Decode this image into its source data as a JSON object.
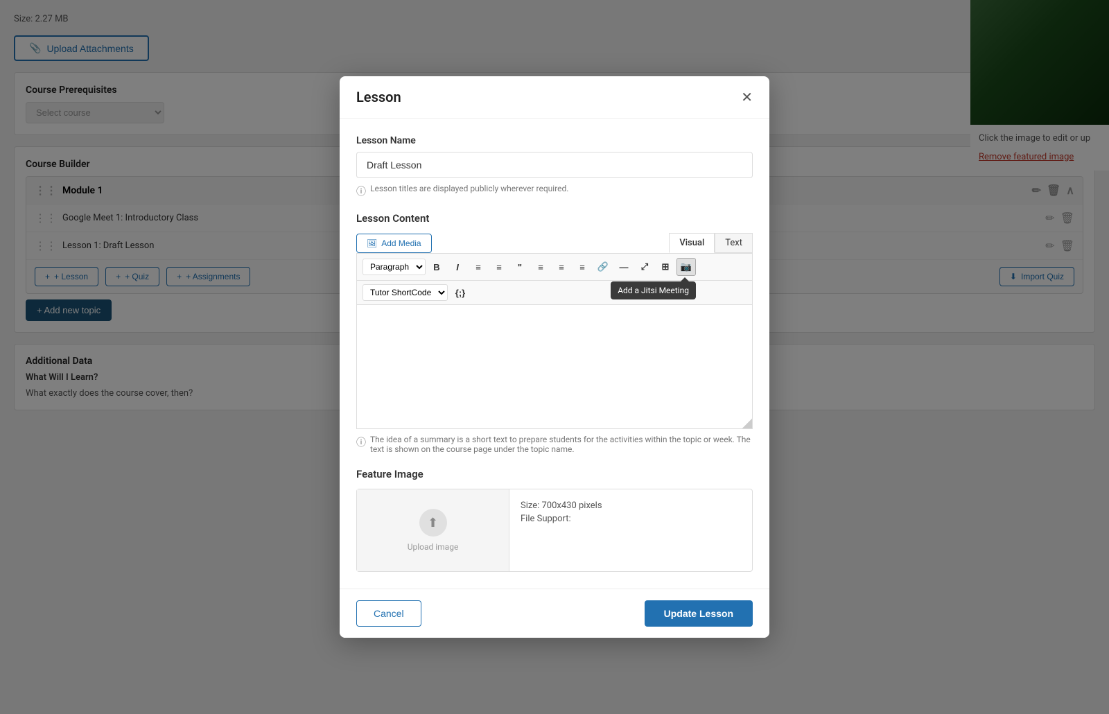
{
  "page": {
    "size_label": "Size: 2.27 MB",
    "upload_btn": "Upload Attachments",
    "remove_featured": "Remove featured image",
    "click_image_text": "Click the image to edit or up"
  },
  "course_prerequisites": {
    "title": "Course Prerequisites",
    "select_placeholder": "Select course"
  },
  "course_builder": {
    "title": "Course Builder",
    "module1": {
      "label": "Module 1",
      "lessons": [
        {
          "name": "Google Meet 1: Introductory Class"
        },
        {
          "name": "Lesson 1: Draft Lesson"
        }
      ]
    },
    "add_lesson": "+ Lesson",
    "add_quiz": "+ Quiz",
    "add_assignments": "+ Assignments",
    "import_quiz": "Import Quiz",
    "add_new_topic": "+ Add new topic"
  },
  "additional_data": {
    "title": "Additional Data",
    "what_will_learn": "What Will I Learn?",
    "learn_text": "What exactly does the course cover, then?"
  },
  "modal": {
    "title": "Lesson",
    "lesson_name_label": "Lesson Name",
    "lesson_name_value": "Draft Lesson",
    "lesson_name_hint": "Lesson titles are displayed publicly wherever required.",
    "lesson_content_label": "Lesson Content",
    "add_media_btn": "Add Media",
    "tab_visual": "Visual",
    "tab_text": "Text",
    "toolbar": {
      "format_select": "Paragraph",
      "bold": "B",
      "italic": "I",
      "unordered_list": "≡",
      "ordered_list": "≡",
      "blockquote": "❝",
      "align_left": "≡",
      "align_center": "≡",
      "align_right": "≡",
      "link": "🔗",
      "horizontal": "—",
      "fullscreen": "⤢",
      "table": "⊞",
      "jitsi": "📷"
    },
    "row2": {
      "shortcode_select": "Tutor ShortCode",
      "curly_btn": "{;}"
    },
    "tooltip_text": "Add a Jitsi Meeting",
    "content_hint": "The idea of a summary is a short text to prepare students for the activities within the topic or week. The text is shown on the course page under the topic name.",
    "feature_image_label": "Feature Image",
    "feature_image": {
      "size_info": "Size: 700x430 pixels",
      "file_support": "File Support:"
    },
    "cancel_btn": "Cancel",
    "update_btn": "Update Lesson"
  }
}
